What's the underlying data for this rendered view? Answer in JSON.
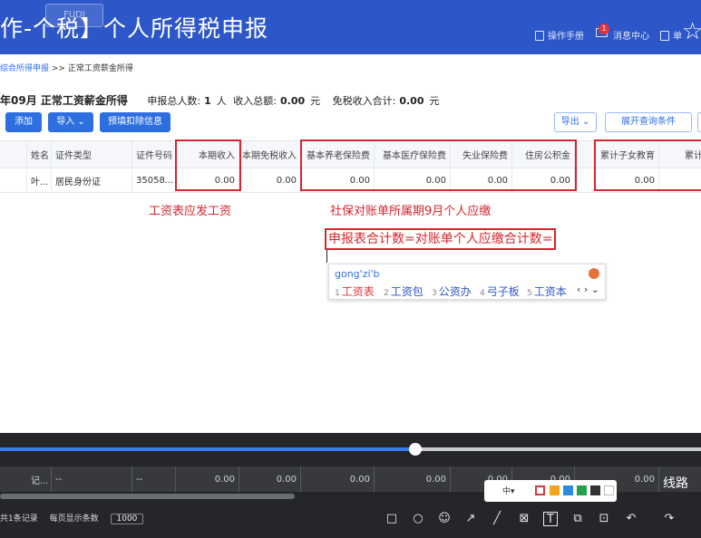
{
  "header": {
    "title": "作-个税】个人所得税申报",
    "watermark": "FUDI",
    "manual": "操作手册",
    "messages": "消息中心",
    "badge": "1",
    "more": "单"
  },
  "breadcrumb": {
    "parent": "综合所得申报",
    "sep": ">>",
    "current": "正常工资薪金所得"
  },
  "summary": {
    "period": "年09月 正常工资薪金所得",
    "count_label": "申报总人数:",
    "count_value": "1",
    "count_unit": "人",
    "income_label": "收入总额:",
    "income_value": "0.00",
    "income_unit": "元",
    "exempt_label": "免税收入合计:",
    "exempt_value": "0.00",
    "exempt_unit": "元"
  },
  "toolbar": {
    "add": "添加",
    "import": "导入",
    "prefill": "预填扣除信息",
    "export": "导出",
    "expand": "展开查询条件"
  },
  "table": {
    "headers": [
      "姓名",
      "证件类型",
      "证件号码",
      "本期收入",
      "本期免税收入",
      "基本养老保险费",
      "基本医疗保险费",
      "失业保险费",
      "住房公积金",
      "累计子女教育",
      "累计"
    ],
    "row": [
      "叶...",
      "居民身份证",
      "35058...",
      "0.00",
      "0.00",
      "0.00",
      "0.00",
      "0.00",
      "0.00",
      "0.00",
      ""
    ]
  },
  "annotations": {
    "salary": "工资表应发工资",
    "social": "社保对账单所属期9月个人应缴",
    "formula": "申报表合计数=对账单个人应缴合计数="
  },
  "ime": {
    "pinyin": "gong'zi'b",
    "candidates": [
      {
        "n": "1",
        "text": "工资表"
      },
      {
        "n": "2",
        "text": "工资包"
      },
      {
        "n": "3",
        "text": "公资办"
      },
      {
        "n": "4",
        "text": "弓子板"
      },
      {
        "n": "5",
        "text": "工资本"
      }
    ],
    "nav": "‹ › ⌄"
  },
  "footer_row": [
    "记...",
    "--",
    "--",
    "0.00",
    "0.00",
    "0.00",
    "0.00",
    "0.00",
    "0.00",
    "0.00"
  ],
  "line_label": "线路",
  "pager": {
    "total": "共1条记录",
    "per_page_label": "每页显示条数",
    "per_page_value": "1000"
  },
  "palette": {
    "lang": "中▾",
    "colors": [
      "#e0343c",
      "#f2a51a",
      "#2d8be0",
      "#23a14a",
      "#333333",
      "#ffffff"
    ]
  },
  "video": {
    "progress": 0.593
  },
  "tools": [
    "□",
    "○",
    "☺",
    "↗",
    "╱",
    "⊠",
    "T",
    "⧉",
    "⊡",
    "↶",
    "↷"
  ],
  "colors": {
    "brand": "#2d57c8",
    "primary": "#2d6fe0",
    "annotation": "#d6262e"
  }
}
